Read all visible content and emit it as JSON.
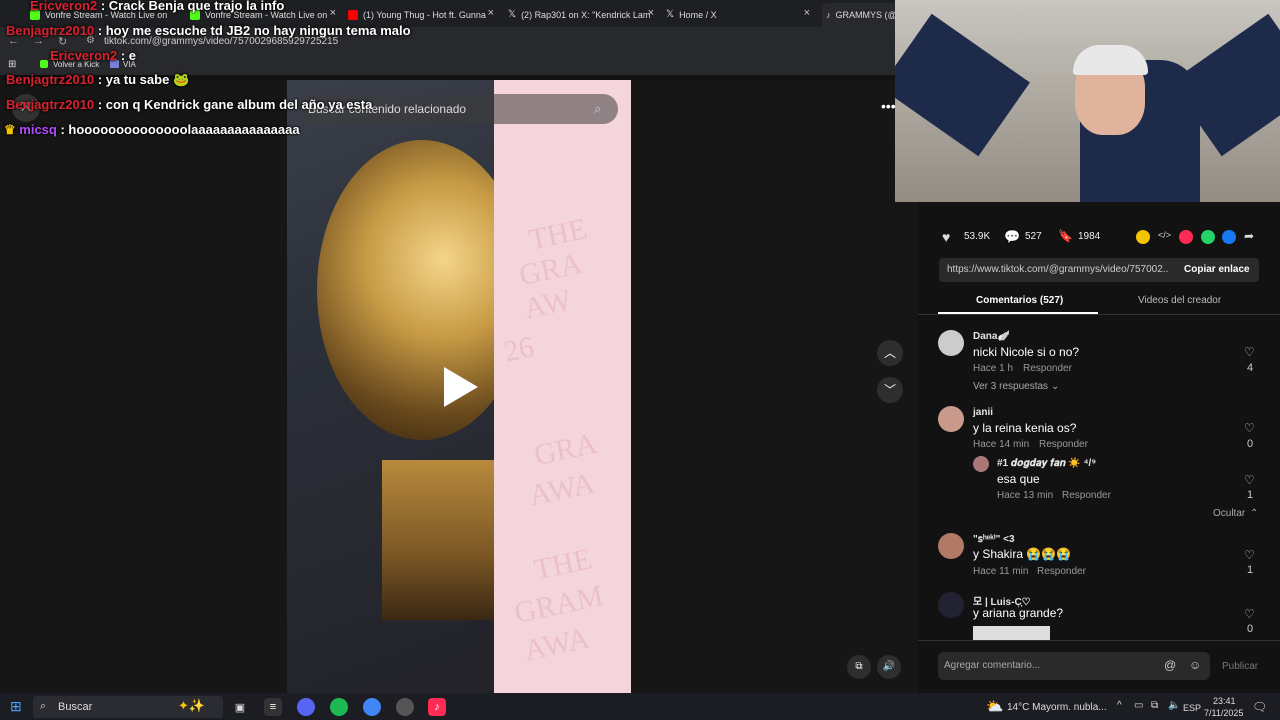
{
  "browser": {
    "tabs": [
      {
        "label": "Vonfre Stream - Watch Live on",
        "color": "#53fc18"
      },
      {
        "label": "Vonfre Stream - Watch Live on",
        "color": "#53fc18"
      },
      {
        "label": "(1) Young Thug - Hot ft. Gunna",
        "color": "#ff0000"
      },
      {
        "label": "(2) Rap301 on X: \"Kendrick Lam",
        "color": "#ffffff"
      },
      {
        "label": "Home / X",
        "color": "#ffffff"
      },
      {
        "label": "GRAMMYS (@g",
        "color": "#ffffff"
      }
    ],
    "url": "tiktok.com/@grammys/video/7570029685929725215",
    "bookmarks": [
      {
        "label": "Volver a Kick"
      },
      {
        "label": "VIA"
      }
    ]
  },
  "chat": [
    {
      "user": "Ericveron2",
      "text": ": Crack Benja que trajo la info",
      "color": "#d8232f"
    },
    {
      "user": "Benjagtrz2010",
      "text": ": hoy me escuche td JB2 no hay ningun tema malo",
      "color": "#d8232f"
    },
    {
      "user": "Ericveron2",
      "text": ": e",
      "color": "#d8232f"
    },
    {
      "user": "Benjagtrz2010",
      "text": ": ya tu sabe",
      "color": "#d8232f"
    },
    {
      "user": "Benjagtrz2010",
      "text": ": con q Kendrick gane album del año ya esta",
      "color": "#d8232f"
    },
    {
      "user": "micsq",
      "text": ": hoooooooooooooolaaaaaaaaaaaaaaa",
      "color": "#b44bff"
    }
  ],
  "search": {
    "placeholder": "Buscar contenido relacionado"
  },
  "video": {
    "overlay_text": [
      "THE",
      "GRA",
      "AW",
      "26",
      "GRA",
      "AWA",
      "THE",
      "GRAM",
      "AWA"
    ]
  },
  "actions": {
    "likes": "53.9K",
    "comments": "527",
    "saves": "1984",
    "link": "https://www.tiktok.com/@grammys/video/757002...",
    "copy_label": "Copiar enlace"
  },
  "tabs": {
    "comments": "Comentarios (527)",
    "creator": "Videos del creador"
  },
  "comments": [
    {
      "name": "Dana🪽",
      "text": "nicki Nicole si o no?",
      "time": "Hace 1 h",
      "reply": "Responder",
      "likes": "4",
      "more": "Ver 3 respuestas"
    },
    {
      "name": "janii",
      "text": "y la reina kenia os?",
      "time": "Hace 14 min",
      "reply": "Responder",
      "likes": "0"
    },
    {
      "name": "#1 𝒅𝒐𝒈𝒅𝒂𝒚 𝒇𝒂𝒏 ☀️ ⁴/⁹",
      "text": "esa que",
      "time": "Hace 13 min",
      "reply": "Responder",
      "likes": "1",
      "hide": "Ocultar"
    },
    {
      "name": "\"ꜱʰᵉᵏⁱ\" <3",
      "text": "y Shakira 😭😭😭",
      "time": "Hace 11 min",
      "reply": "Responder",
      "likes": "1"
    },
    {
      "name": "모 | Luis-C᷊᷊᷊♡",
      "text": "y ariana grande?",
      "likes": "0"
    }
  ],
  "composer": {
    "placeholder": "Agregar comentario...",
    "publish": "Publicar"
  },
  "taskbar": {
    "search": "Buscar",
    "weather": "14°C  Mayorm. nubla...",
    "lang": "ESP",
    "time": "23:41",
    "date": "7/11/2025"
  }
}
